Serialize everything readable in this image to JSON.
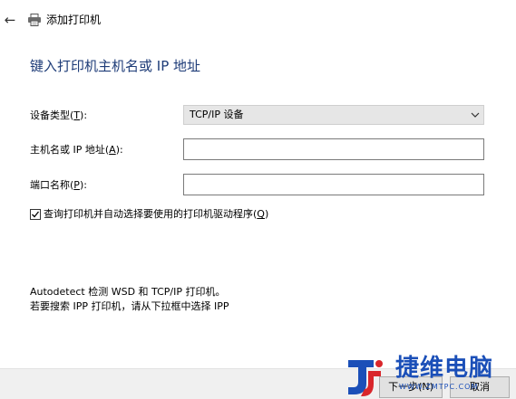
{
  "titlebar": {
    "title": "添加打印机",
    "back_icon": "back-arrow-icon",
    "app_icon": "printer-icon"
  },
  "heading": "键入打印机主机名或 IP 地址",
  "form": {
    "device_type": {
      "label_prefix": "设备类型(",
      "label_key": "T",
      "label_suffix": "):",
      "value": "TCP/IP 设备"
    },
    "hostname": {
      "label_prefix": "主机名或 IP 地址(",
      "label_key": "A",
      "label_suffix": "):",
      "value": ""
    },
    "port": {
      "label_prefix": "端口名称(",
      "label_key": "P",
      "label_suffix": "):",
      "value": ""
    },
    "auto_driver": {
      "checked": true,
      "label_prefix": "查询打印机并自动选择要使用的打印机驱动程序(",
      "label_key": "Q",
      "label_suffix": ")"
    }
  },
  "info": {
    "line1": "Autodetect 检测 WSD 和 TCP/IP 打印机。",
    "line2": "若要搜索 IPP 打印机，请从下拉框中选择 IPP"
  },
  "footer": {
    "next_label": "下一步(N)",
    "cancel_label": "取消"
  },
  "watermark": {
    "text": "捷维电脑",
    "url": "WWW.ZMTPC.COM"
  },
  "colors": {
    "heading": "#1e3c78",
    "select_bg": "#e6e6e6",
    "footer_bg": "#f0f0f0",
    "watermark_blue": "#1b4fb8",
    "watermark_red": "#d9262b"
  }
}
